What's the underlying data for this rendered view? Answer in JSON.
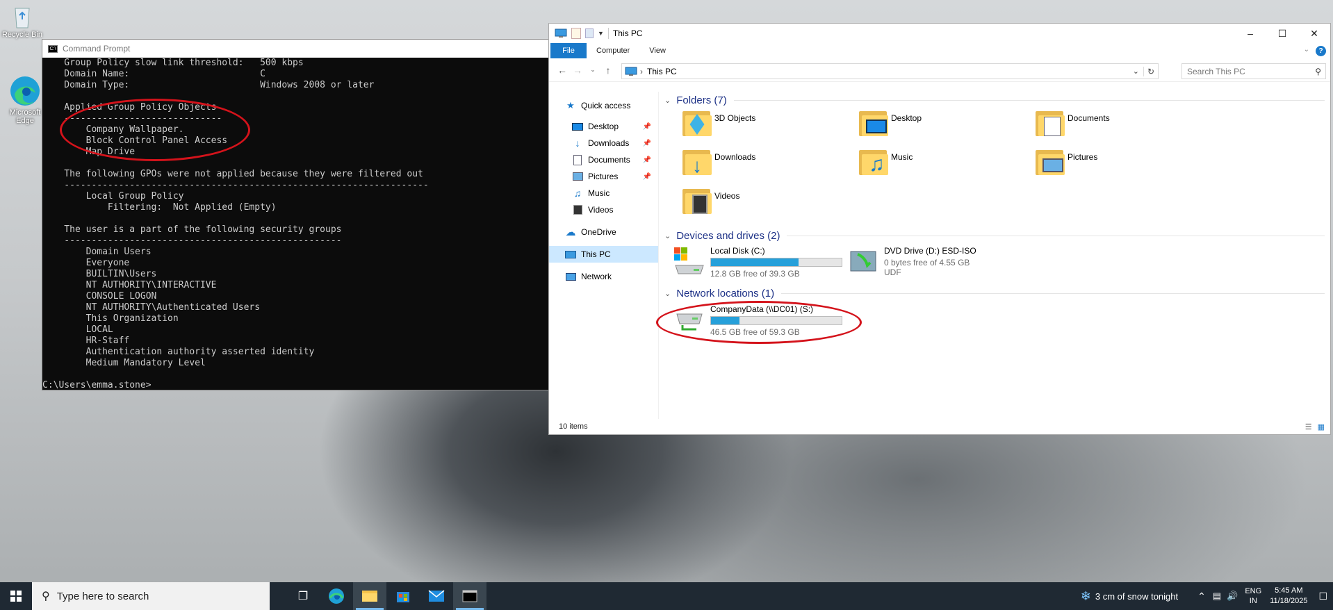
{
  "desktop": {
    "icons": [
      {
        "label": "Recycle Bin"
      },
      {
        "label": "Microsoft Edge"
      }
    ]
  },
  "cmd": {
    "title": "Command Prompt",
    "lines": [
      "    Group Policy slow link threshold:   500 kbps",
      "    Domain Name:                        C",
      "    Domain Type:                        Windows 2008 or later",
      "",
      "    Applied Group Policy Objects",
      "    -----------------------------",
      "        Company Wallpaper.",
      "        Block Control Panel Access",
      "        Map Drive",
      "",
      "    The following GPOs were not applied because they were filtered out",
      "    -------------------------------------------------------------------",
      "        Local Group Policy",
      "            Filtering:  Not Applied (Empty)",
      "",
      "    The user is a part of the following security groups",
      "    ---------------------------------------------------",
      "        Domain Users",
      "        Everyone",
      "        BUILTIN\\Users",
      "        NT AUTHORITY\\INTERACTIVE",
      "        CONSOLE LOGON",
      "        NT AUTHORITY\\Authenticated Users",
      "        This Organization",
      "        LOCAL",
      "        HR-Staff",
      "        Authentication authority asserted identity",
      "        Medium Mandatory Level",
      "",
      "C:\\Users\\emma.stone>"
    ]
  },
  "explorer": {
    "title": "This PC",
    "ribbon": {
      "file": "File",
      "computer": "Computer",
      "view": "View",
      "help": "?"
    },
    "address": "This PC",
    "search_placeholder": "Search This PC",
    "nav": [
      {
        "label": "Quick access",
        "icon": "star-icon",
        "pinned": false
      },
      {
        "label": "Desktop",
        "icon": "desktop-icon",
        "pinned": true
      },
      {
        "label": "Downloads",
        "icon": "download-icon",
        "pinned": true
      },
      {
        "label": "Documents",
        "icon": "documents-icon",
        "pinned": true
      },
      {
        "label": "Pictures",
        "icon": "pictures-icon",
        "pinned": true
      },
      {
        "label": "Music",
        "icon": "music-icon",
        "pinned": false
      },
      {
        "label": "Videos",
        "icon": "videos-icon",
        "pinned": false
      },
      {
        "label": "OneDrive",
        "icon": "cloud-icon",
        "pinned": false
      },
      {
        "label": "This PC",
        "icon": "computer-icon",
        "pinned": false
      },
      {
        "label": "Network",
        "icon": "network-icon",
        "pinned": false
      }
    ],
    "groups": {
      "folders": "Folders (7)",
      "devices": "Devices and drives (2)",
      "network": "Network locations (1)"
    },
    "folders": [
      "3D Objects",
      "Desktop",
      "Documents",
      "Downloads",
      "Music",
      "Pictures",
      "Videos"
    ],
    "drives": [
      {
        "name": "Local Disk (C:)",
        "free": "12.8 GB free of 39.3 GB",
        "used_fraction": 0.67
      },
      {
        "name": "DVD Drive (D:) ESD-ISO",
        "free": "0 bytes free of 4.55 GB",
        "fs": "UDF"
      }
    ],
    "network_locations": [
      {
        "name": "CompanyData (\\\\DC01) (S:)",
        "free": "46.5 GB free of 59.3 GB",
        "used_fraction": 0.22
      }
    ],
    "status": "10 items"
  },
  "taskbar": {
    "search_placeholder": "Type here to search",
    "weather": "3 cm of snow tonight",
    "lang1": "ENG",
    "lang2": "IN",
    "time": "5:45 AM",
    "date": "11/18/2025"
  },
  "colors": {
    "accent": "#1979ca",
    "bar_fill": "#26a0da",
    "annotation_red": "#d4131b",
    "taskbar": "#1f2933"
  }
}
